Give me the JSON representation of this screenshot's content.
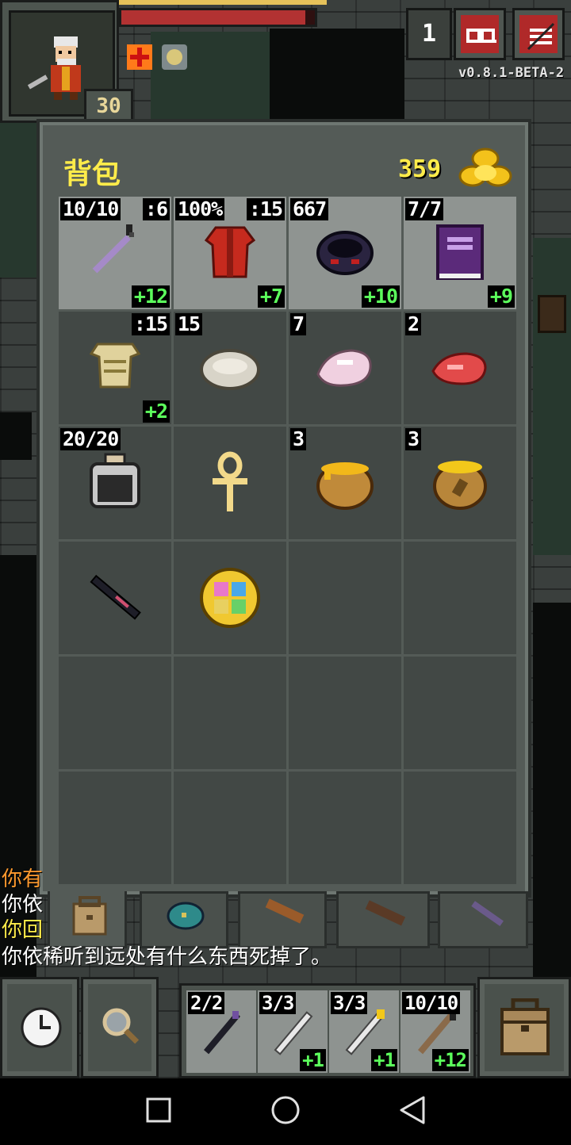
{
  "hud": {
    "depth": "1",
    "level": "30",
    "version": "v0.8.1-BETA-2",
    "hp_fraction": 0.95
  },
  "backpack": {
    "title": "背包",
    "gold": "359",
    "slots": [
      {
        "icon": "staff-icon",
        "top_left": "10/10",
        "top_right": ":6",
        "bottom_right": "+12",
        "equipped": true
      },
      {
        "icon": "red-robe-icon",
        "top_left": "100%",
        "top_right": ":15",
        "bottom_right": "+7",
        "equipped": true
      },
      {
        "icon": "dark-bracelet-icon",
        "top_left": "667",
        "top_right": "",
        "bottom_right": "+10",
        "equipped": true
      },
      {
        "icon": "spellbook-icon",
        "top_left": "7/7",
        "top_right": "",
        "bottom_right": "+9",
        "equipped": true
      },
      {
        "icon": "cloth-armor-icon",
        "top_left": "",
        "top_right": ":15",
        "bottom_right": "+2",
        "equipped": false
      },
      {
        "icon": "stone-icon",
        "top_left": "15",
        "top_right": "",
        "bottom_right": "",
        "equipped": false
      },
      {
        "icon": "pink-meat-icon",
        "top_left": "7",
        "top_right": "",
        "bottom_right": "",
        "equipped": false
      },
      {
        "icon": "raw-meat-icon",
        "top_left": "2",
        "top_right": "",
        "bottom_right": "",
        "equipped": false
      },
      {
        "icon": "dew-vial-icon",
        "top_left": "20/20",
        "top_right": "",
        "bottom_right": "",
        "equipped": false
      },
      {
        "icon": "ankh-icon",
        "top_left": "",
        "top_right": "",
        "bottom_right": "",
        "equipped": false
      },
      {
        "icon": "honey-pot-icon",
        "top_left": "3",
        "top_right": "",
        "bottom_right": "",
        "equipped": false
      },
      {
        "icon": "seed-pouch-icon",
        "top_left": "3",
        "top_right": "",
        "bottom_right": "",
        "equipped": false
      },
      {
        "icon": "dark-wand-icon",
        "top_left": "",
        "top_right": "",
        "bottom_right": "",
        "equipped": false
      },
      {
        "icon": "gem-amulet-icon",
        "top_left": "",
        "top_right": "",
        "bottom_right": "",
        "equipped": false
      },
      {
        "icon": "",
        "top_left": "",
        "top_right": "",
        "bottom_right": "",
        "equipped": false
      },
      {
        "icon": "",
        "top_left": "",
        "top_right": "",
        "bottom_right": "",
        "equipped": false
      },
      {
        "icon": "",
        "top_left": "",
        "top_right": "",
        "bottom_right": "",
        "equipped": false
      },
      {
        "icon": "",
        "top_left": "",
        "top_right": "",
        "bottom_right": "",
        "equipped": false
      },
      {
        "icon": "",
        "top_left": "",
        "top_right": "",
        "bottom_right": "",
        "equipped": false
      },
      {
        "icon": "",
        "top_left": "",
        "top_right": "",
        "bottom_right": "",
        "equipped": false
      },
      {
        "icon": "",
        "top_left": "",
        "top_right": "",
        "bottom_right": "",
        "equipped": false
      },
      {
        "icon": "",
        "top_left": "",
        "top_right": "",
        "bottom_right": "",
        "equipped": false
      },
      {
        "icon": "",
        "top_left": "",
        "top_right": "",
        "bottom_right": "",
        "equipped": false
      },
      {
        "icon": "",
        "top_left": "",
        "top_right": "",
        "bottom_right": "",
        "equipped": false
      }
    ],
    "tabs": [
      "backpack-tab-icon",
      "seed-pouch-tab-icon",
      "scroll-holder-tab-icon",
      "potion-bandolier-tab-icon",
      "wand-holster-tab-icon"
    ]
  },
  "log": [
    {
      "text": "你有",
      "color": "#ff9a2e"
    },
    {
      "text": "你依",
      "color": "#ffffff"
    },
    {
      "text": "你回",
      "color": "#ffec4a"
    },
    {
      "text": "你依稀听到远处有什么东西死掉了。",
      "color": "#ffffff"
    }
  ],
  "quickslots": [
    {
      "icon": "dark-wand-icon",
      "top_left": "2/2",
      "bottom_right": ""
    },
    {
      "icon": "white-wand-icon",
      "top_left": "3/3",
      "bottom_right": "+1"
    },
    {
      "icon": "gold-tip-wand-icon",
      "top_left": "3/3",
      "bottom_right": "+1"
    },
    {
      "icon": "staff-icon",
      "top_left": "10/10",
      "bottom_right": "+12"
    }
  ],
  "colors": {
    "gold_text": "#ffec4a",
    "bonus_text": "#5cff5c",
    "panel": "#545b57",
    "equipped_slot": "#8f9491"
  }
}
